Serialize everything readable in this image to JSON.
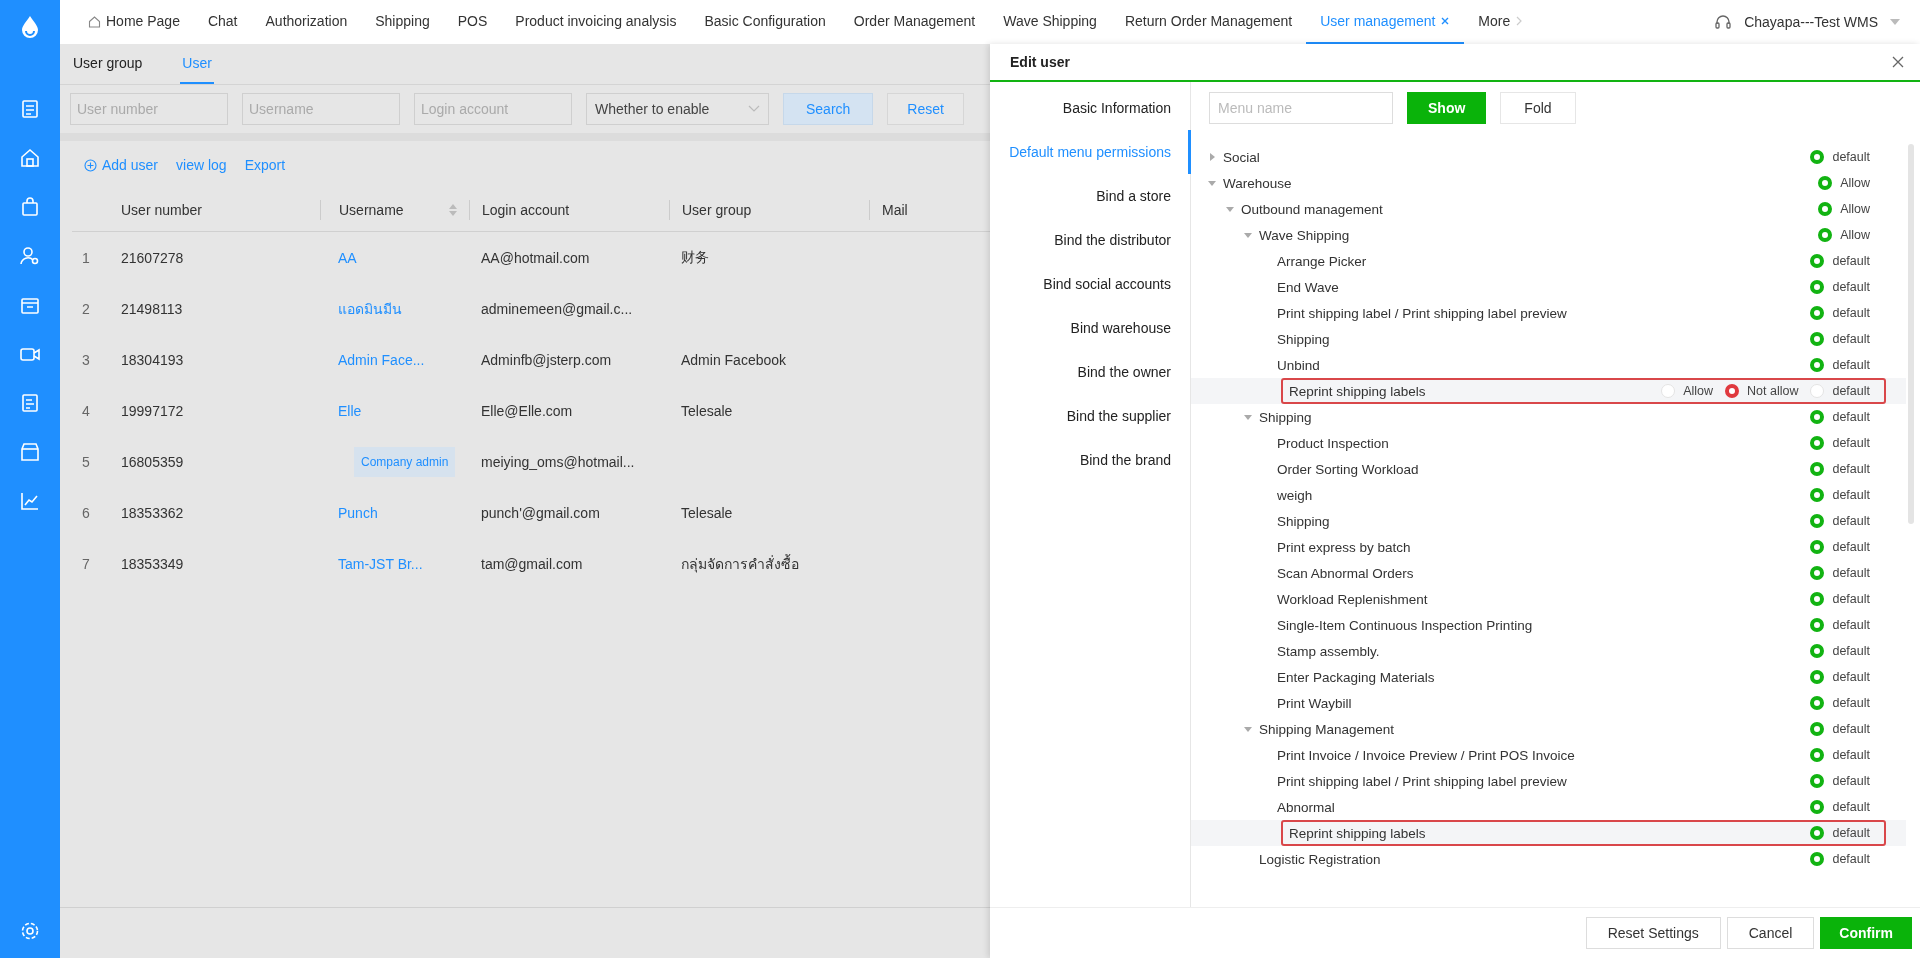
{
  "top_nav": {
    "tabs": [
      {
        "label": "Home Page",
        "selected": false,
        "kind": "home",
        "closable": false
      },
      {
        "label": "Chat",
        "selected": false,
        "kind": "plain",
        "closable": false
      },
      {
        "label": "Authorization",
        "selected": false,
        "kind": "plain",
        "closable": false
      },
      {
        "label": "Shipping",
        "selected": false,
        "kind": "plain",
        "closable": false
      },
      {
        "label": "POS",
        "selected": false,
        "kind": "plain",
        "closable": false
      },
      {
        "label": "Product invoicing analysis",
        "selected": false,
        "kind": "plain",
        "closable": false
      },
      {
        "label": "Basic Configuration",
        "selected": false,
        "kind": "plain",
        "closable": false
      },
      {
        "label": "Order Management",
        "selected": false,
        "kind": "plain",
        "closable": false
      },
      {
        "label": "Wave Shipping",
        "selected": false,
        "kind": "plain",
        "closable": false
      },
      {
        "label": "Return Order Management",
        "selected": false,
        "kind": "plain",
        "closable": false
      },
      {
        "label": "User management",
        "selected": true,
        "kind": "plain",
        "closable": true
      }
    ],
    "more": "More",
    "account": "Chayapa---Test WMS"
  },
  "page": {
    "tabs": [
      {
        "label": "User group",
        "selected": false
      },
      {
        "label": "User",
        "selected": true
      }
    ],
    "filters": [
      {
        "kind": "input",
        "placeholder": "User number"
      },
      {
        "kind": "input",
        "placeholder": "Username"
      },
      {
        "kind": "input",
        "placeholder": "Login account"
      },
      {
        "kind": "select",
        "value": "Whether to enable"
      }
    ],
    "buttons": [
      {
        "label": "Search",
        "kind": "primary"
      },
      {
        "label": "Reset",
        "kind": "plain"
      }
    ],
    "actions": [
      {
        "label": "Add user",
        "kind": "add"
      },
      {
        "label": "view log",
        "kind": "link"
      },
      {
        "label": "Export",
        "kind": "link"
      }
    ],
    "columns": [
      {
        "label": "User number",
        "sortable": false
      },
      {
        "label": "Username",
        "sortable": true
      },
      {
        "label": "Login account",
        "sortable": false
      },
      {
        "label": "User group",
        "sortable": false
      },
      {
        "label": "Mail",
        "sortable": false
      }
    ],
    "rows": [
      {
        "index": "1",
        "user_number": "21607278",
        "username": "AA",
        "login": "AA@hotmail.com",
        "group": "财务"
      },
      {
        "index": "2",
        "user_number": "21498113",
        "username": "แอดมินมีน",
        "login": "adminemeen@gmail.c..."
      },
      {
        "index": "3",
        "user_number": "18304193",
        "username": "Admin Face...",
        "login": "Adminfb@jsterp.com",
        "group": "Admin Facebook"
      },
      {
        "index": "4",
        "user_number": "19997172",
        "username": "Elle",
        "login": "Elle@Elle.com",
        "group": "Telesale"
      },
      {
        "index": "5",
        "user_number": "16805359",
        "tooltip": "Company admin",
        "login": "meiying_oms@hotmail..."
      },
      {
        "index": "6",
        "user_number": "18353362",
        "username": "Punch",
        "login": "punch'@gmail.com",
        "group": "Telesale"
      },
      {
        "index": "7",
        "user_number": "18353349",
        "username": "Tam-JST Br...",
        "login": "tam@gmail.com",
        "group": "กลุ่มจัดการคำสั่งซื้อ"
      }
    ]
  },
  "drawer": {
    "title": "Edit user",
    "nav": [
      {
        "label": "Basic Information",
        "selected": false
      },
      {
        "label": "Default menu permissions",
        "selected": true
      },
      {
        "label": "Bind a store",
        "selected": false
      },
      {
        "label": "Bind the distributor",
        "selected": false
      },
      {
        "label": "Bind social accounts",
        "selected": false
      },
      {
        "label": "Bind warehouse",
        "selected": false
      },
      {
        "label": "Bind the owner",
        "selected": false
      },
      {
        "label": "Bind the supplier",
        "selected": false
      },
      {
        "label": "Bind the brand",
        "selected": false
      }
    ],
    "search": {
      "placeholder": "Menu name"
    },
    "buttons": [
      {
        "label": "Show",
        "kind": "primary"
      },
      {
        "label": "Fold",
        "kind": "plain"
      }
    ],
    "tree": [
      {
        "label": "Social",
        "expanded": false,
        "highlighted": false,
        "options": [
          {
            "label": "default",
            "selected": true
          }
        ]
      },
      {
        "label": "Warehouse",
        "expanded": true,
        "highlighted": false,
        "options": [
          {
            "label": "Allow",
            "selected": true
          }
        ],
        "children": [
          {
            "label": "Outbound management",
            "expanded": true,
            "highlighted": false,
            "options": [
              {
                "label": "Allow",
                "selected": true
              }
            ],
            "children": [
              {
                "label": "Wave Shipping",
                "expanded": true,
                "highlighted": false,
                "options": [
                  {
                    "label": "Allow",
                    "selected": true
                  }
                ],
                "children": [
                  {
                    "label": "Arrange Picker",
                    "highlighted": false,
                    "options": [
                      {
                        "label": "default",
                        "selected": true
                      }
                    ]
                  },
                  {
                    "label": "End Wave",
                    "highlighted": false,
                    "options": [
                      {
                        "label": "default",
                        "selected": true
                      }
                    ]
                  },
                  {
                    "label": "Print shipping label / Print shipping label preview",
                    "highlighted": false,
                    "options": [
                      {
                        "label": "default",
                        "selected": true
                      }
                    ]
                  },
                  {
                    "label": "Shipping",
                    "highlighted": false,
                    "options": [
                      {
                        "label": "default",
                        "selected": true
                      }
                    ]
                  },
                  {
                    "label": "Unbind",
                    "highlighted": false,
                    "options": [
                      {
                        "label": "default",
                        "selected": true
                      }
                    ]
                  },
                  {
                    "label": "Reprint shipping labels",
                    "highlighted": true,
                    "options": [
                      {
                        "label": "Allow",
                        "selected": false
                      },
                      {
                        "label": "Not allow",
                        "color": "#e0393e",
                        "selected": true
                      },
                      {
                        "label": "default",
                        "selected": false
                      }
                    ]
                  }
                ]
              },
              {
                "label": "Shipping",
                "expanded": true,
                "highlighted": false,
                "options": [
                  {
                    "label": "default",
                    "selected": true
                  }
                ],
                "children": [
                  {
                    "label": "Product Inspection",
                    "highlighted": false,
                    "options": [
                      {
                        "label": "default",
                        "selected": true
                      }
                    ]
                  },
                  {
                    "label": "Order Sorting Workload",
                    "highlighted": false,
                    "options": [
                      {
                        "label": "default",
                        "selected": true
                      }
                    ]
                  },
                  {
                    "label": "weigh",
                    "highlighted": false,
                    "options": [
                      {
                        "label": "default",
                        "selected": true
                      }
                    ]
                  },
                  {
                    "label": "Shipping",
                    "highlighted": false,
                    "options": [
                      {
                        "label": "default",
                        "selected": true
                      }
                    ]
                  },
                  {
                    "label": "Print express by batch",
                    "highlighted": false,
                    "options": [
                      {
                        "label": "default",
                        "selected": true
                      }
                    ]
                  },
                  {
                    "label": "Scan Abnormal Orders",
                    "highlighted": false,
                    "options": [
                      {
                        "label": "default",
                        "selected": true
                      }
                    ]
                  },
                  {
                    "label": "Workload Replenishment",
                    "highlighted": false,
                    "options": [
                      {
                        "label": "default",
                        "selected": true
                      }
                    ]
                  },
                  {
                    "label": "Single-Item Continuous Inspection Printing",
                    "highlighted": false,
                    "options": [
                      {
                        "label": "default",
                        "selected": true
                      }
                    ]
                  },
                  {
                    "label": "Stamp assembly.",
                    "highlighted": false,
                    "options": [
                      {
                        "label": "default",
                        "selected": true
                      }
                    ]
                  },
                  {
                    "label": "Enter Packaging Materials",
                    "highlighted": false,
                    "options": [
                      {
                        "label": "default",
                        "selected": true
                      }
                    ]
                  },
                  {
                    "label": "Print Waybill",
                    "highlighted": false,
                    "options": [
                      {
                        "label": "default",
                        "selected": true
                      }
                    ]
                  }
                ]
              },
              {
                "label": "Shipping Management",
                "expanded": true,
                "highlighted": false,
                "options": [
                  {
                    "label": "default",
                    "selected": true
                  }
                ],
                "children": [
                  {
                    "label": "Print Invoice / Invoice Preview / Print POS Invoice",
                    "highlighted": false,
                    "options": [
                      {
                        "label": "default",
                        "selected": true
                      }
                    ]
                  },
                  {
                    "label": "Print shipping label / Print shipping label preview",
                    "highlighted": false,
                    "options": [
                      {
                        "label": "default",
                        "selected": true
                      }
                    ]
                  },
                  {
                    "label": "Abnormal",
                    "highlighted": false,
                    "options": [
                      {
                        "label": "default",
                        "selected": true
                      }
                    ]
                  },
                  {
                    "label": "Reprint shipping labels",
                    "highlighted": true,
                    "options": [
                      {
                        "label": "default",
                        "selected": true
                      }
                    ]
                  }
                ]
              },
              {
                "label": "Logistic Registration",
                "highlighted": false,
                "options": [
                  {
                    "label": "default",
                    "selected": true
                  }
                ]
              }
            ]
          }
        ]
      }
    ],
    "footer": [
      {
        "label": "Reset Settings",
        "kind": "plain"
      },
      {
        "label": "Cancel",
        "kind": "plain"
      },
      {
        "label": "Confirm",
        "kind": "primary"
      }
    ]
  }
}
